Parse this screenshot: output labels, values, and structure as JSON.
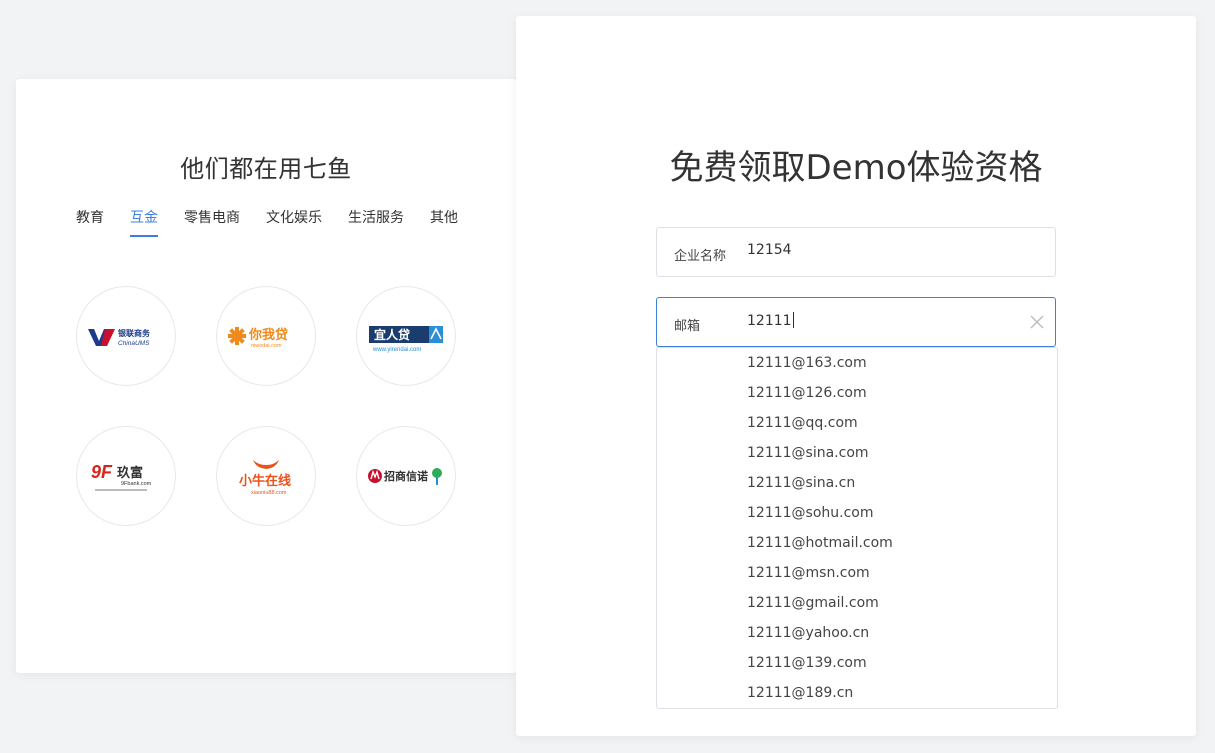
{
  "left": {
    "title": "他们都在用七鱼",
    "tabs": [
      "教育",
      "互金",
      "零售电商",
      "文化娱乐",
      "生活服务",
      "其他"
    ],
    "active_tab": "互金",
    "logos": [
      {
        "name": "银联商务",
        "sub": "ChinaUMS"
      },
      {
        "name": "你我贷",
        "sub": "niwodai.com"
      },
      {
        "name": "宜人贷",
        "sub": "www.yirendai.com"
      },
      {
        "name": "玖富",
        "sub": "9Fbank.com"
      },
      {
        "name": "小牛在线",
        "sub": "xiaoniu88.com"
      },
      {
        "name": "招商信诺",
        "sub": ""
      }
    ]
  },
  "form": {
    "title": "免费领取Demo体验资格",
    "company": {
      "label": "企业名称",
      "value": "12154"
    },
    "email": {
      "label": "邮箱",
      "value": "12111"
    },
    "suggestions": [
      "12111@163.com",
      "12111@126.com",
      "12111@qq.com",
      "12111@sina.com",
      "12111@sina.cn",
      "12111@sohu.com",
      "12111@hotmail.com",
      "12111@msn.com",
      "12111@gmail.com",
      "12111@yahoo.cn",
      "12111@139.com",
      "12111@189.cn"
    ]
  },
  "colors": {
    "accent": "#3d7fe0",
    "border": "#dcdfe6",
    "background": "#f2f3f5"
  }
}
